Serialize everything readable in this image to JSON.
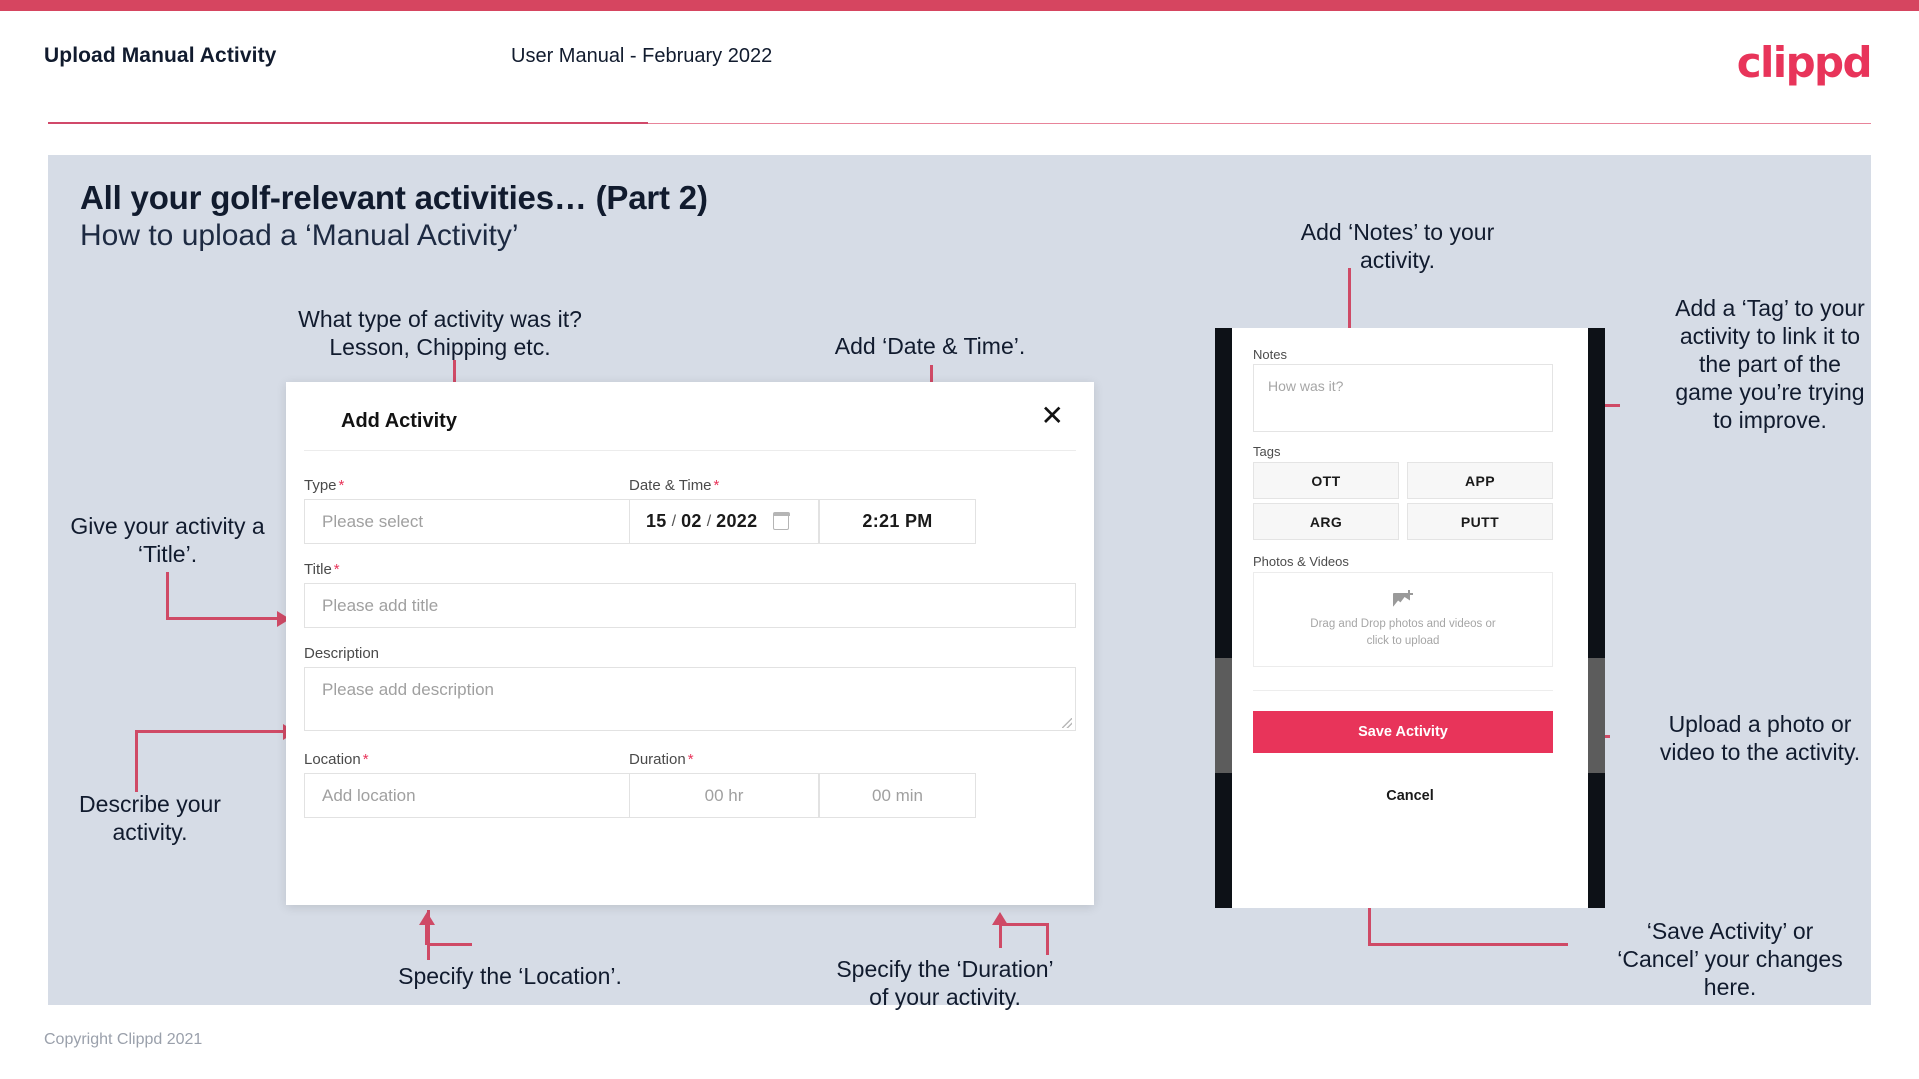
{
  "header": {
    "left_title": "Upload Manual Activity",
    "center_title": "User Manual - February 2022",
    "logo": "clippd"
  },
  "slide": {
    "title": "All your golf-relevant activities… (Part 2)",
    "subtitle": "How to upload a ‘Manual Activity’"
  },
  "annotations": {
    "type": "What type of activity was it?\nLesson, Chipping etc.",
    "datetime": "Add ‘Date & Time’.",
    "title": "Give your activity a\n‘Title’.",
    "description": "Describe your\nactivity.",
    "location": "Specify the ‘Location’.",
    "duration": "Specify the ‘Duration’\nof your activity.",
    "notes": "Add ‘Notes’ to your\nactivity.",
    "tags": "Add a ‘Tag’ to your\nactivity to link it to\nthe part of the\ngame you’re trying\nto improve.",
    "photos": "Upload a photo or\nvideo to the activity.",
    "save_cancel": "‘Save Activity’ or\n‘Cancel’ your changes\nhere."
  },
  "modal": {
    "title": "Add Activity",
    "close_icon": "close-icon",
    "fields": {
      "type": {
        "label": "Type",
        "required": "*",
        "placeholder": "Please select",
        "caret_icon": "chevron-down-icon"
      },
      "datetime": {
        "label": "Date & Time",
        "required": "*",
        "day": "15",
        "month": "02",
        "year": "2022",
        "separator": "/",
        "calendar_icon": "calendar-icon",
        "time": "2:21 PM"
      },
      "title": {
        "label": "Title",
        "required": "*",
        "placeholder": "Please add title"
      },
      "description": {
        "label": "Description",
        "required": "",
        "placeholder": "Please add description"
      },
      "location": {
        "label": "Location",
        "required": "*",
        "placeholder": "Add location"
      },
      "duration": {
        "label": "Duration",
        "required": "*",
        "hours_placeholder": "00 hr",
        "minutes_placeholder": "00 min"
      }
    }
  },
  "phone": {
    "notes": {
      "label": "Notes",
      "placeholder": "How was it?"
    },
    "tags": {
      "label": "Tags",
      "items": [
        {
          "label": "OTT"
        },
        {
          "label": "APP"
        },
        {
          "label": "ARG"
        },
        {
          "label": "PUTT"
        }
      ]
    },
    "photos": {
      "label": "Photos & Videos",
      "dropzone_line1": "Drag and Drop photos and videos or",
      "dropzone_line2": "click to upload",
      "upload_icon": "add-photo-icon"
    },
    "save_label": "Save Activity",
    "cancel_label": "Cancel"
  },
  "footer": {
    "copyright": "Copyright Clippd 2021"
  },
  "colors": {
    "brand_pink": "#e8345a",
    "top_bar": "#d64560",
    "slide_bg": "#d6dce6",
    "annotation_line": "#cf4a66",
    "text_dark": "#111b2e"
  }
}
